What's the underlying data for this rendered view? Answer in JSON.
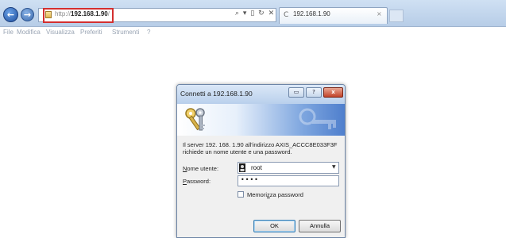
{
  "browser": {
    "address_bar": {
      "url_proto": "http://",
      "url_host": "192.168.1.90",
      "url_tail": "/",
      "tools": [
        "⌕",
        "▾",
        "▯",
        "↻",
        "✕"
      ]
    },
    "tab": {
      "title": "192.168.1.90",
      "close": "×"
    },
    "menu": [
      "File",
      "Modifica",
      "Visualizza",
      "Preferiti",
      "Strumenti",
      "?"
    ]
  },
  "dialog": {
    "title": "Connetti a 192.168.1.90",
    "help_glyph": "?",
    "close_glyph": "x",
    "message": "Il server 192. 168. 1.90 all'indirizzo AXIS_ACCC8E033F3F richiede un nome utente e una password.",
    "username_label_first": "N",
    "username_label_rest": "ome utente:",
    "username_value": "root",
    "password_label_first": "P",
    "password_label_rest": "assword:",
    "password_value": "••••",
    "remember_label_pre": "Memori",
    "remember_label_u": "z",
    "remember_label_post": "za password",
    "ok_label": "OK",
    "cancel_label": "Annulla"
  },
  "colors": {
    "highlight_box": "#d32f2f",
    "banner_blue": "#4f7fcd"
  }
}
